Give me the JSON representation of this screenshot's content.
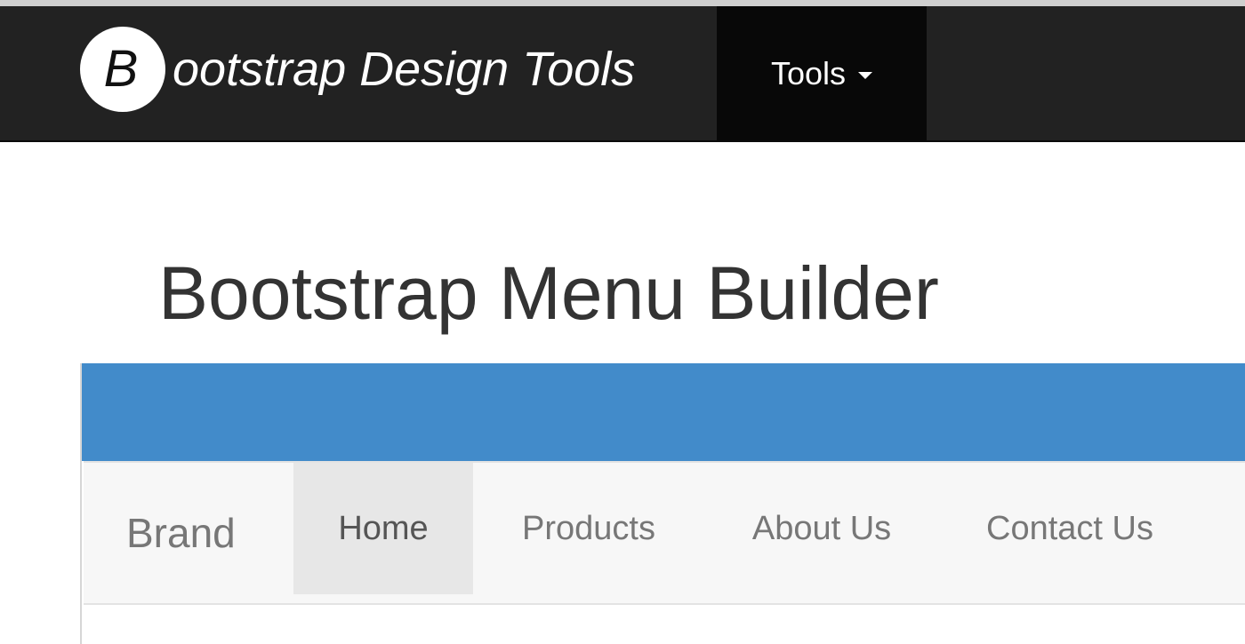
{
  "topnav": {
    "logo_letter": "B",
    "logo_text": "ootstrap Design Tools",
    "tools_label": "Tools",
    "tools_icon": "caret-down-icon"
  },
  "page": {
    "title": "Bootstrap Menu Builder"
  },
  "preview": {
    "header_color": "#428bca",
    "brand": "Brand",
    "nav_items": [
      {
        "label": "Home",
        "active": true
      },
      {
        "label": "Products",
        "active": false
      },
      {
        "label": "About Us",
        "active": false
      },
      {
        "label": "Contact Us",
        "active": false
      }
    ]
  }
}
